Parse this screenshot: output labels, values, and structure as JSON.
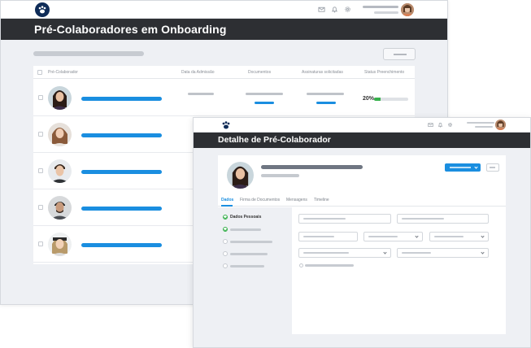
{
  "back_window": {
    "title": "Pré-Colaboradores em Onboarding",
    "columns": [
      "Pré-Colaborador",
      "Data da Admissão",
      "Documentos",
      "Assinaturas solicitadas",
      "Status Preenchimento"
    ],
    "rows": [
      {
        "progress_label": "20%",
        "progress": 0.2
      },
      {},
      {},
      {},
      {}
    ]
  },
  "front_window": {
    "title": "Detalhe de Pré-Colaborador",
    "tabs": [
      "Dados",
      "Firma de Documentos",
      "Mensagens",
      "Timeline"
    ],
    "steps": {
      "first_label": "Dados Pessoais"
    }
  },
  "colors": {
    "accent": "#1a8ee0",
    "titlebar": "#2d2f33",
    "success": "#36b04b",
    "logo": "#0f2c58"
  },
  "icons": [
    "paw-logo-icon",
    "mail-icon",
    "bell-icon",
    "gear-icon"
  ]
}
